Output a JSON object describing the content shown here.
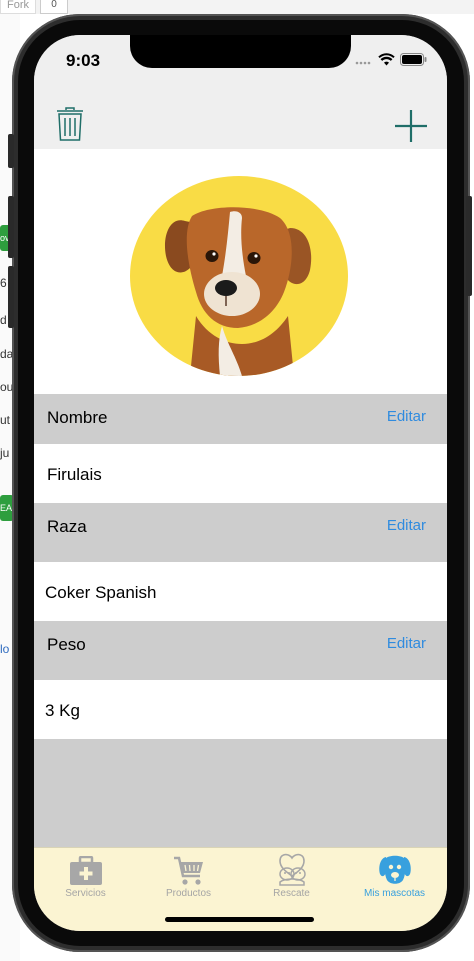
{
  "background": {
    "tab_fragment": "Fork",
    "tab_count": "0",
    "left_fragments": [
      "6 j",
      "d",
      "da",
      "ou",
      "ut",
      "ju",
      "lo"
    ],
    "left_buttons": [
      "ov",
      "EA"
    ]
  },
  "status_bar": {
    "time": "9:03"
  },
  "nav": {
    "delete_icon": "trash-icon",
    "add_icon": "plus-icon"
  },
  "pet": {
    "photo_alt": "dog-photo",
    "photo_bg": "#f9dc45"
  },
  "fields": [
    {
      "label": "Nombre",
      "edit": "Editar",
      "value": "Firulais"
    },
    {
      "label": "Raza",
      "edit": "Editar",
      "value": "Coker Spanish"
    },
    {
      "label": "Peso",
      "edit": "Editar",
      "value": "3 Kg"
    }
  ],
  "tabs": [
    {
      "label": "Servicios",
      "icon": "medical-kit-icon",
      "active": false
    },
    {
      "label": "Productos",
      "icon": "shopping-cart-icon",
      "active": false
    },
    {
      "label": "Rescate",
      "icon": "rescue-pets-icon",
      "active": false
    },
    {
      "label": "Mis mascotas",
      "icon": "dog-face-icon",
      "active": true
    }
  ],
  "colors": {
    "accent": "#2f8bdf",
    "active_tab": "#38a0de",
    "tabbar_bg": "#fbf4d2",
    "section_header": "#cdcdcd",
    "nav_icon": "#1f6e68"
  }
}
